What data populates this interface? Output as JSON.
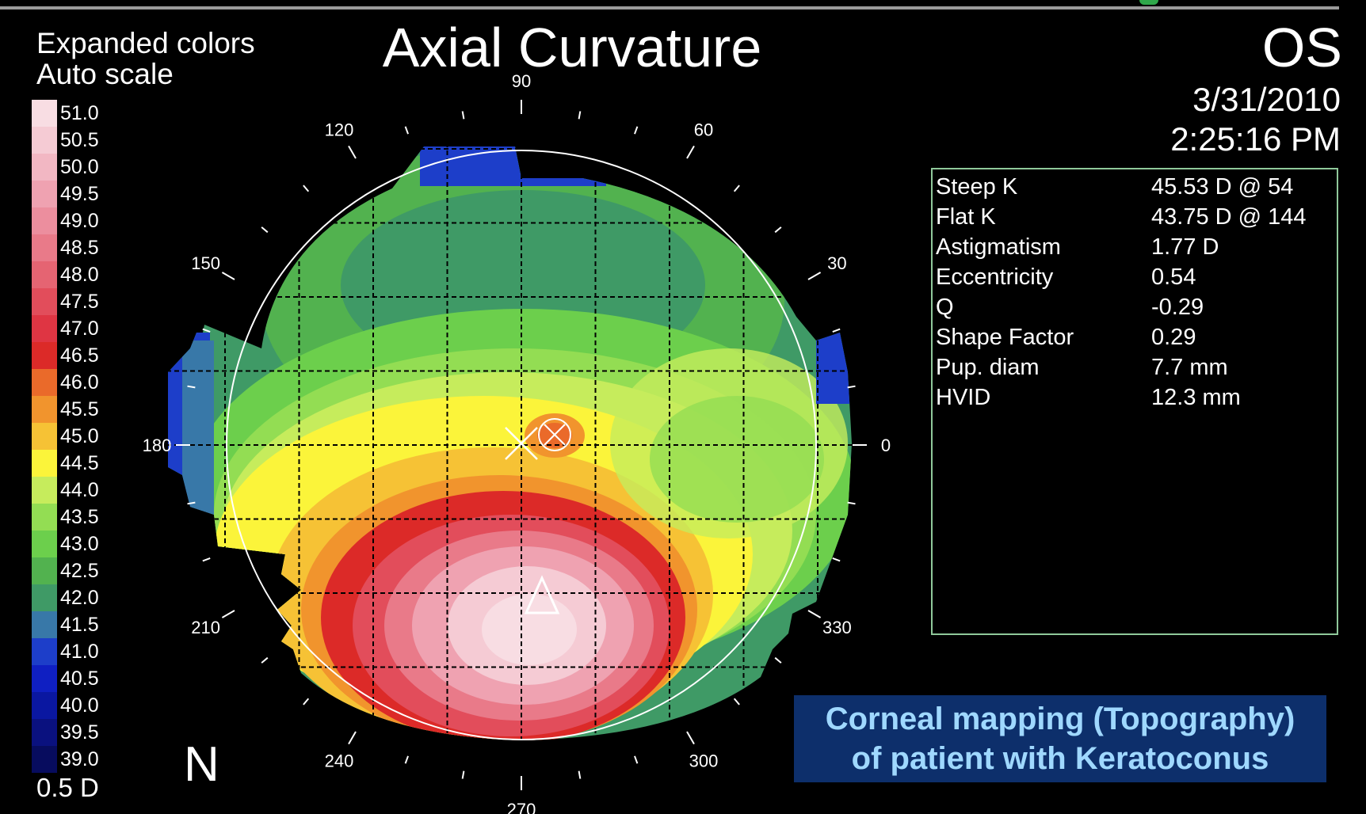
{
  "header": {
    "title": "Axial Curvature",
    "eye": "OS",
    "date": "3/31/2010",
    "time": "2:25:16 PM"
  },
  "scale": {
    "color_mode": "Expanded colors",
    "scale_mode": "Auto scale",
    "step": "0.5 D",
    "items": [
      {
        "value": "51.0",
        "color": "#f8dde3"
      },
      {
        "value": "50.5",
        "color": "#f5cbd4"
      },
      {
        "value": "50.0",
        "color": "#f2b7c3"
      },
      {
        "value": "49.5",
        "color": "#efa2b1"
      },
      {
        "value": "49.0",
        "color": "#ec8e9e"
      },
      {
        "value": "48.5",
        "color": "#e97a89"
      },
      {
        "value": "48.0",
        "color": "#e56472"
      },
      {
        "value": "47.5",
        "color": "#e24d5b"
      },
      {
        "value": "47.0",
        "color": "#df3543"
      },
      {
        "value": "46.5",
        "color": "#dc2a28"
      },
      {
        "value": "46.0",
        "color": "#ea6a2a"
      },
      {
        "value": "45.5",
        "color": "#f1942d"
      },
      {
        "value": "45.0",
        "color": "#f6c235"
      },
      {
        "value": "44.5",
        "color": "#fbf43a"
      },
      {
        "value": "44.0",
        "color": "#c6ec5c"
      },
      {
        "value": "43.5",
        "color": "#93dd53"
      },
      {
        "value": "43.0",
        "color": "#6ccf4c"
      },
      {
        "value": "42.5",
        "color": "#52b24f"
      },
      {
        "value": "42.0",
        "color": "#3f9a66"
      },
      {
        "value": "41.5",
        "color": "#3878a8"
      },
      {
        "value": "41.0",
        "color": "#1d3ec9"
      },
      {
        "value": "40.5",
        "color": "#0f1fc2"
      },
      {
        "value": "40.0",
        "color": "#0a17a1"
      },
      {
        "value": "39.5",
        "color": "#0a117f"
      },
      {
        "value": "39.0",
        "color": "#070c5e"
      }
    ]
  },
  "map": {
    "nasal_marker": "N",
    "angle_labels": [
      "0",
      "30",
      "60",
      "90",
      "120",
      "150",
      "180",
      "210",
      "240",
      "270",
      "300",
      "330"
    ]
  },
  "stats": [
    {
      "label": "Steep  K",
      "value": "45.53 D @ 54"
    },
    {
      "label": "Flat K",
      "value": "43.75 D @ 144"
    },
    {
      "label": "Astigmatism",
      "value": "1.77 D"
    },
    {
      "label": "Eccentricity",
      "value": "0.54"
    },
    {
      "label": "Q",
      "value": "-0.29"
    },
    {
      "label": "Shape  Factor",
      "value": "0.29"
    },
    {
      "label": "Pup.  diam",
      "value": "7.7 mm"
    },
    {
      "label": "HVID",
      "value": "12.3 mm"
    }
  ],
  "caption": {
    "line1": "Corneal mapping (Topography)",
    "line2": "of patient with Keratoconus"
  }
}
